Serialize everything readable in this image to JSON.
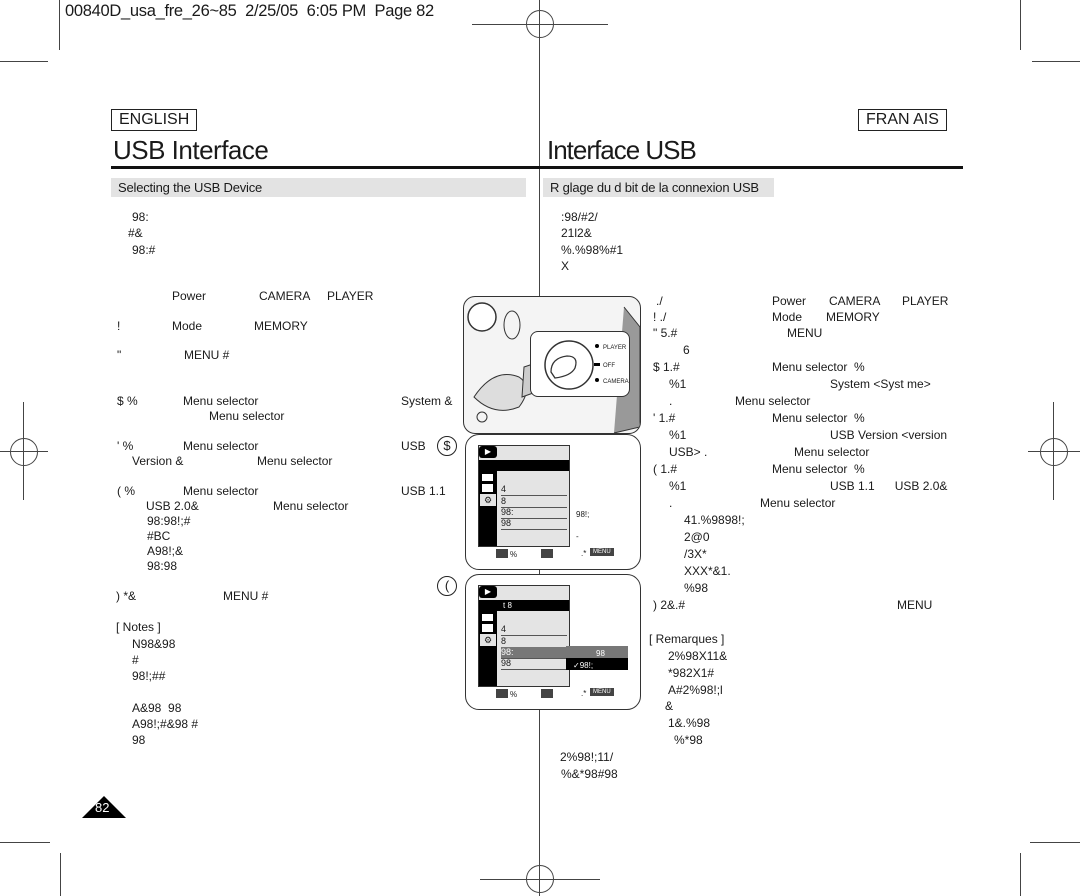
{
  "slug": "00840D_usa_fre_26~85  2/25/05  6:05 PM  Page 82",
  "english": {
    "lang_label": "ENGLISH",
    "title": "USB Interface",
    "section": "Selecting the USB Device",
    "intro": [
      "98:",
      "#&",
      "98:#"
    ],
    "steps": [
      {
        "n": "",
        "a": "Power",
        "b": "CAMERA",
        "c": "PLAYER"
      },
      {
        "n": "!",
        "a": "Mode",
        "b": "MEMORY"
      },
      {
        "n": "\"",
        "a": "MENU #"
      },
      {
        "n": "$ %",
        "a": "Menu selector",
        "b": "System &",
        "cont": "Menu selector"
      },
      {
        "n": "' %",
        "a": "Menu selector",
        "b": "USB",
        "cont1": "Version &",
        "cont2": "Menu selector"
      },
      {
        "n": "( %",
        "a": "Menu selector",
        "b": "USB 1.1",
        "cont1": "USB 2.0&",
        "cont2": "Menu selector",
        "extra": [
          "98:98!;#",
          "#BC",
          "A98!;&",
          "98:98"
        ]
      },
      {
        "n": ") *&",
        "a": "MENU #"
      }
    ],
    "notes_label": "[ Notes ]",
    "notes": [
      "N98&98",
      "#",
      "98!;##",
      "",
      "A&98  98",
      "A98!;#&98 #",
      "98"
    ],
    "page_number": "82"
  },
  "french": {
    "lang_label": "FRAN AIS",
    "title": "Interface USB",
    "section": "R glage du d bit de la connexion USB",
    "intro": [
      ":98/#2/",
      "21l2&",
      "%.%98%#1",
      "X"
    ],
    "steps": [
      {
        "n": "./",
        "a": "Power",
        "b": "CAMERA",
        "c": "PLAYER"
      },
      {
        "n": "! ./",
        "a": "Mode",
        "b": "MEMORY"
      },
      {
        "n": "\" 5.#",
        "a": "MENU",
        "cont": "6"
      },
      {
        "n": "$ 1.#",
        "a": "Menu selector  %",
        "l2a": "%1",
        "l2b": "System <Syst me>",
        "l3a": ".",
        "l3b": "Menu selector"
      },
      {
        "n": "' 1.#",
        "a": "Menu selector  %",
        "l2a": "%1",
        "l2b": "USB Version <version",
        "l3a": "USB> .",
        "l3b": "Menu selector"
      },
      {
        "n": "( 1.#",
        "a": "Menu selector  %",
        "l2a": "%1",
        "l2b": "USB 1.1      USB 2.0&",
        "l3a": ".",
        "l3b": "Menu selector",
        "extra": [
          "41.%9898!;",
          "2@0",
          "/3X*",
          "XXX*&1.",
          "%98"
        ]
      },
      {
        "n": ") 2&.#",
        "a": "MENU"
      }
    ],
    "notes_label": "[ Remarques ]",
    "notes": [
      "2%98X11&",
      "*982X1#",
      "A#2%98!;l",
      "&",
      "1&.%98",
      "%*98"
    ],
    "footer": [
      "2%98!;11/",
      "%&*98#98"
    ]
  },
  "figure": {
    "dial_labels": [
      "PLAYER",
      "OFF",
      "CAMERA"
    ],
    "step4_marker": "$",
    "step6_marker": "(",
    "screen_a": {
      "header": "",
      "rows": [
        "",
        "4",
        "8",
        "98:",
        "98",
        ""
      ],
      "value": "98!;",
      "value2": "-",
      "footer": {
        "move": "%",
        "select": "",
        "exit": ".*",
        "menu": "MENU"
      }
    },
    "screen_b": {
      "header": "t 8",
      "rows": [
        "",
        "4",
        "8",
        "98:",
        "98",
        ""
      ],
      "opt1": "98",
      "opt2": "✓98!;",
      "footer": {
        "move": "%",
        "select": "",
        "exit": ".*",
        "menu": "MENU"
      }
    }
  }
}
